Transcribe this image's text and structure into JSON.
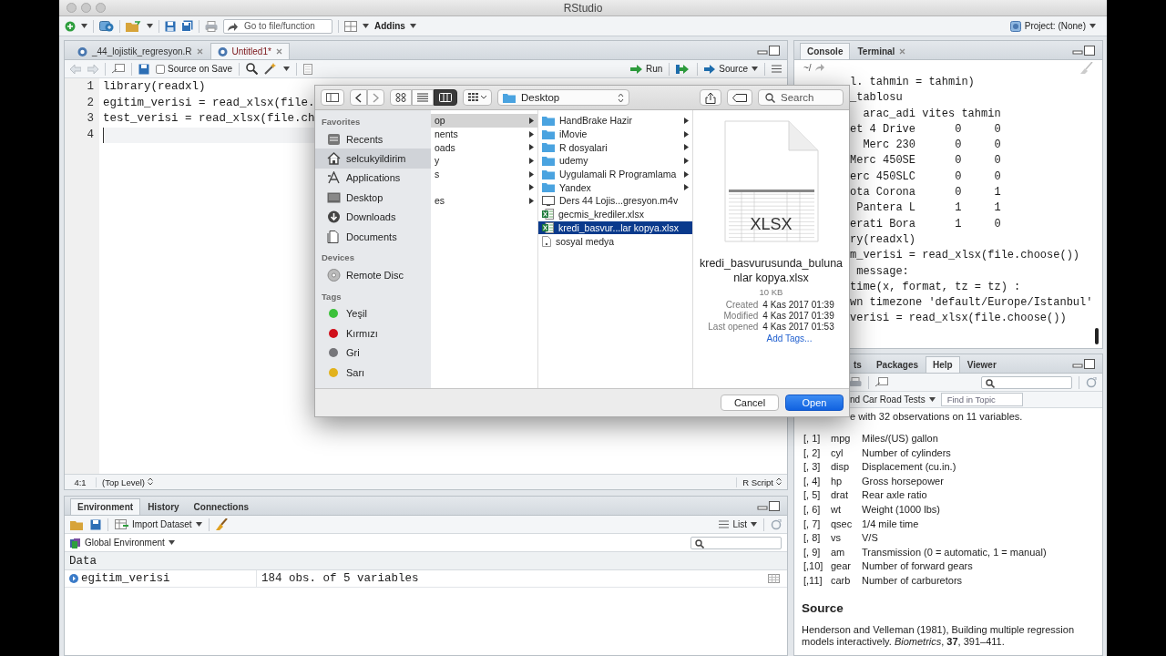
{
  "window": {
    "title": "RStudio"
  },
  "toolbar": {
    "goto_placeholder": "Go to file/function",
    "addins": "Addins",
    "project": "Project: (None)"
  },
  "source": {
    "tabs": [
      {
        "label": "_44_lojistik_regresyon.R",
        "selected": false
      },
      {
        "label": "Untitled1*",
        "selected": true
      }
    ],
    "source_on_save": {
      "label": "Source on Save",
      "checked": false
    },
    "run": "Run",
    "source_button": "Source",
    "lines": [
      {
        "number": "1",
        "code": "library(readxl)"
      },
      {
        "number": "2",
        "code": "egitim_verisi = read_xlsx(file."
      },
      {
        "number": "3",
        "code": "test_verisi = read_xlsx(file.ch"
      },
      {
        "number": "4"
      }
    ],
    "status": {
      "position": "4:1",
      "scope": "(Top Level)",
      "file_type": "R Script"
    }
  },
  "environment": {
    "tabs": [
      {
        "label": "Environment",
        "selected": true
      },
      {
        "label": "History",
        "selected": false
      },
      {
        "label": "Connections",
        "selected": false
      }
    ],
    "import": "Import Dataset",
    "view": "List",
    "scope": "Global Environment",
    "section": "Data",
    "rows": [
      {
        "name": "egitim_verisi",
        "value": "184 obs. of 5 variables"
      }
    ]
  },
  "console": {
    "tabs": [
      {
        "label": "Console",
        "selected": true,
        "closable": false
      },
      {
        "label": "Terminal",
        "selected": false,
        "closable": true
      }
    ],
    "path": "~/",
    "lines": [
      "l. tahmin = tahmin)",
      "_tablosu",
      "  arac_adi vites tahmin",
      "et 4 Drive      0     0",
      "  Merc 230      0     0",
      "Merc 450SE      0     0",
      "erc 450SLC      0     0",
      "ota Corona      0     1",
      " Pantera L      1     1",
      "erati Bora      1     0",
      "ry(readxl)",
      "m_verisi = read_xlsx(file.choose())",
      " message:",
      "time(x, format, tz = tz) :",
      "wn timezone 'default/Europe/Istanbul'",
      "verisi = read_xlsx(file.choose())"
    ]
  },
  "help": {
    "tabs": [
      {
        "label": "ts",
        "selected": false
      },
      {
        "label": "Packages",
        "selected": false
      },
      {
        "label": "Help",
        "selected": true
      },
      {
        "label": "Viewer",
        "selected": false
      }
    ],
    "topic": "nd Car Road Tests",
    "find_placeholder": "Find in Topic",
    "intro": "e with 32 observations on 11 variables.",
    "variables": [
      {
        "index": "[, 1]",
        "name": "mpg",
        "description": "Miles/(US) gallon"
      },
      {
        "index": "[, 2]",
        "name": "cyl",
        "description": "Number of cylinders"
      },
      {
        "index": "[, 3]",
        "name": "disp",
        "description": "Displacement (cu.in.)"
      },
      {
        "index": "[, 4]",
        "name": "hp",
        "description": "Gross horsepower"
      },
      {
        "index": "[, 5]",
        "name": "drat",
        "description": "Rear axle ratio"
      },
      {
        "index": "[, 6]",
        "name": "wt",
        "description": "Weight (1000 lbs)"
      },
      {
        "index": "[, 7]",
        "name": "qsec",
        "description": "1/4 mile time"
      },
      {
        "index": "[, 8]",
        "name": "vs",
        "description": "V/S"
      },
      {
        "index": "[, 9]",
        "name": "am",
        "description": "Transmission (0 = automatic, 1 = manual)"
      },
      {
        "index": "[,10]",
        "name": "gear",
        "description": "Number of forward gears"
      },
      {
        "index": "[,11]",
        "name": "carb",
        "description": "Number of carburetors"
      }
    ],
    "source_heading": "Source",
    "citation": "Henderson and Velleman (1981), Building multiple regression models interactively. *Biometrics*, **37**, 391–411."
  },
  "dialog": {
    "location": "Desktop",
    "search_placeholder": "Search",
    "view_modes": [
      {
        "kind": "icons",
        "selected": false
      },
      {
        "kind": "list",
        "selected": false
      },
      {
        "kind": "columns",
        "selected": true
      }
    ],
    "sidebar": [
      {
        "heading": "Favorites",
        "items": [
          {
            "label": "Recents",
            "kind": "recents",
            "selected": false
          },
          {
            "label": "selcukyildirim",
            "kind": "home",
            "selected": true
          },
          {
            "label": "Applications",
            "kind": "applications",
            "selected": false
          },
          {
            "label": "Desktop",
            "kind": "desktop",
            "selected": false
          },
          {
            "label": "Downloads",
            "kind": "downloads",
            "selected": false
          },
          {
            "label": "Documents",
            "kind": "documents",
            "selected": false
          }
        ]
      },
      {
        "heading": "Devices",
        "items": [
          {
            "label": "Remote Disc",
            "kind": "disc",
            "selected": false
          }
        ]
      },
      {
        "heading": "Tags",
        "items": [
          {
            "label": "Yeşil",
            "kind": "tag",
            "color": "#3cc13b",
            "selected": false
          },
          {
            "label": "Kırmızı",
            "kind": "tag",
            "color": "#d0101b",
            "selected": false
          },
          {
            "label": "Gri",
            "kind": "tag",
            "color": "#76767a",
            "selected": false
          },
          {
            "label": "Sarı",
            "kind": "tag",
            "color": "#e2b21c",
            "selected": false
          }
        ]
      }
    ],
    "column_1": [
      {
        "label": "op",
        "selected": true,
        "has_children": true
      },
      {
        "label": "nents",
        "selected": false,
        "has_children": true
      },
      {
        "label": "oads",
        "selected": false,
        "has_children": true
      },
      {
        "label": "y",
        "selected": false,
        "has_children": true
      },
      {
        "label": "s",
        "selected": false,
        "has_children": true
      },
      {
        "selected": false,
        "has_children": true
      },
      {
        "label": "es",
        "selected": false,
        "has_children": true
      }
    ],
    "column_2": [
      {
        "label": "HandBrake Hazir",
        "kind": "folder",
        "selected": false,
        "has_children": true
      },
      {
        "label": "iMovie",
        "kind": "folder",
        "selected": false,
        "has_children": true
      },
      {
        "label": "R dosyalari",
        "kind": "folder",
        "selected": false,
        "has_children": true
      },
      {
        "label": "udemy",
        "kind": "folder",
        "selected": false,
        "has_children": true
      },
      {
        "label": "Uygulamali R Programlama",
        "kind": "folder",
        "selected": false,
        "has_children": true
      },
      {
        "label": "Yandex",
        "kind": "folder",
        "selected": false,
        "has_children": true
      },
      {
        "label": "Ders 44 Lojis...gresyon.m4v",
        "kind": "video",
        "selected": false,
        "has_children": false
      },
      {
        "label": "gecmis_krediler.xlsx",
        "kind": "spreadsheet",
        "selected": false,
        "has_children": false
      },
      {
        "label": "kredi_basvur...lar kopya.xlsx",
        "kind": "spreadsheet",
        "selected": true,
        "has_children": false
      },
      {
        "label": "sosyal medya",
        "kind": "document",
        "selected": false,
        "has_children": false
      }
    ],
    "preview": {
      "badge": "XLSX",
      "name": "kredi_basvurusunda_bulunanlar kopya.xlsx",
      "size": "10 KB",
      "details": [
        {
          "label": "Created",
          "value": "4 Kas 2017 01:39"
        },
        {
          "label": "Modified",
          "value": "4 Kas 2017 01:39"
        },
        {
          "label": "Last opened",
          "value": "4 Kas 2017 01:53"
        }
      ],
      "add_tags": "Add Tags..."
    },
    "buttons": [
      {
        "label": "Cancel",
        "default": false
      },
      {
        "label": "Open",
        "default": true
      }
    ]
  }
}
